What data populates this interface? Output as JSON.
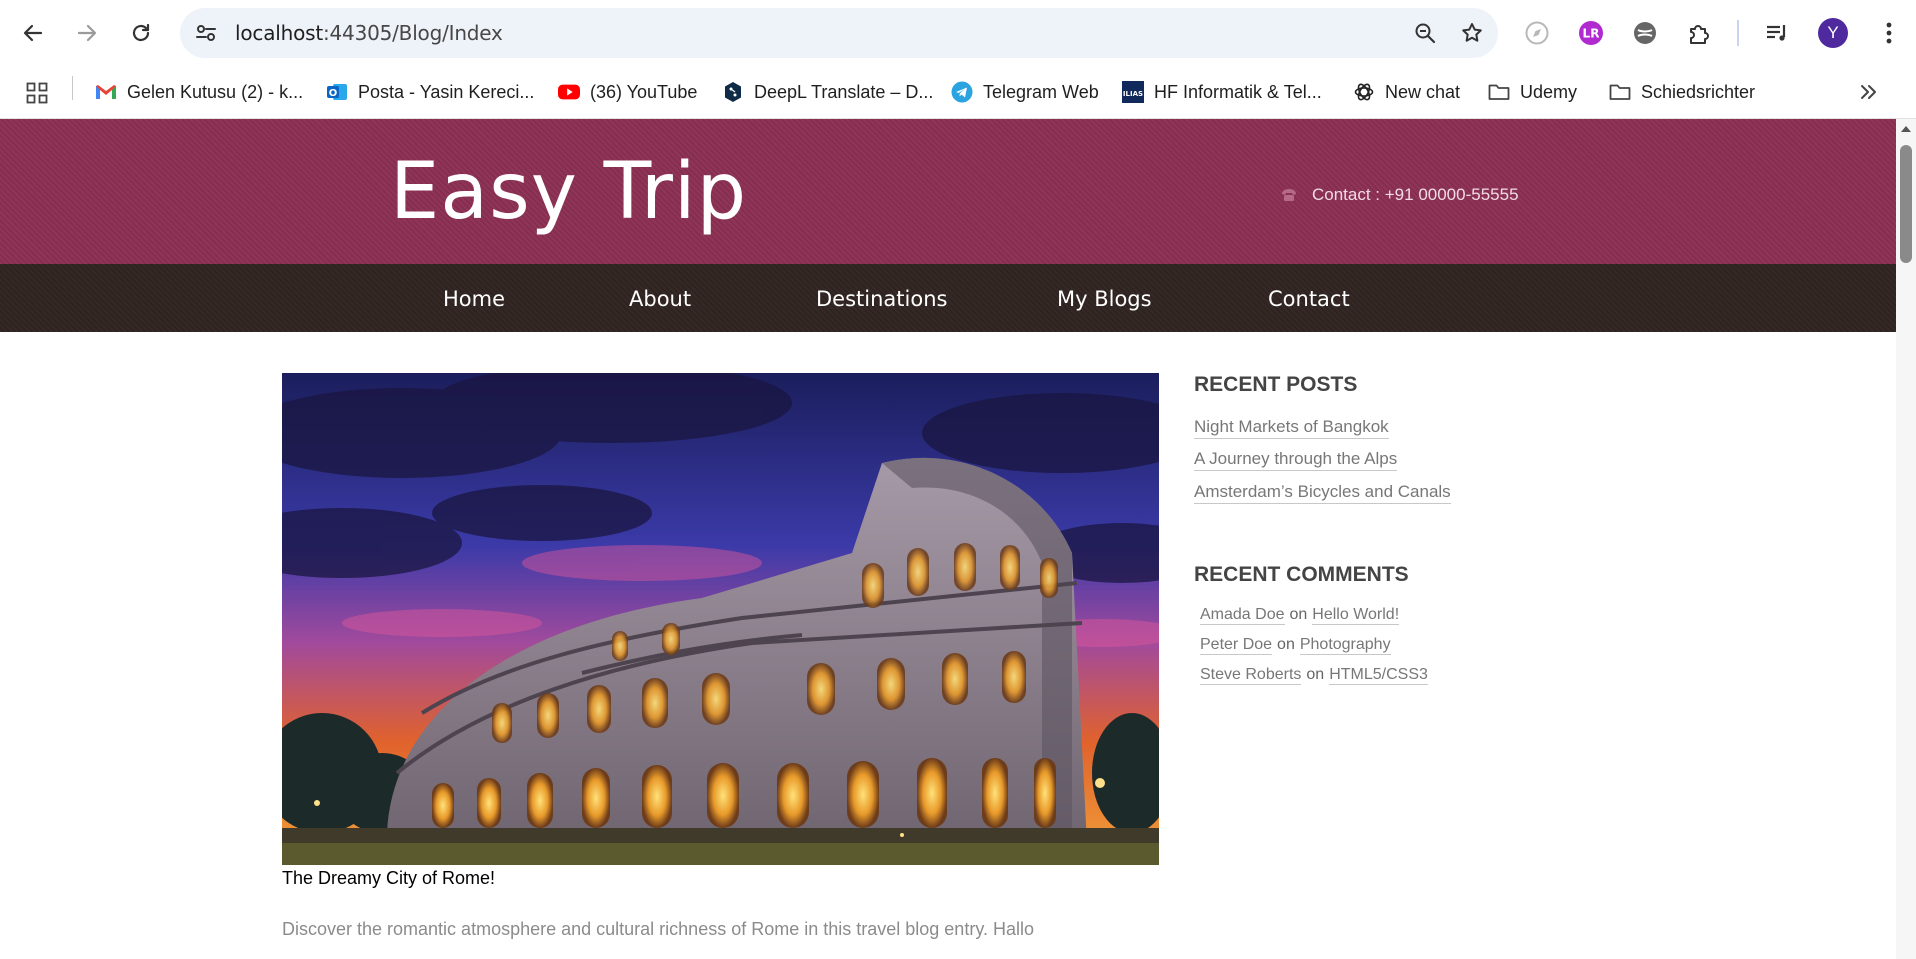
{
  "browser": {
    "url_host": "localhost",
    "url_rest": ":44305/Blog/Index",
    "avatar_letter": "Y"
  },
  "bookmarks": [
    {
      "label": "Gelen Kutusu (2) - k...",
      "icon": "gmail-icon"
    },
    {
      "label": "Posta - Yasin Kereci...",
      "icon": "outlook-icon"
    },
    {
      "label": "(36) YouTube",
      "icon": "youtube-icon"
    },
    {
      "label": "DeepL Translate – D...",
      "icon": "deepl-icon"
    },
    {
      "label": "Telegram Web",
      "icon": "telegram-icon"
    },
    {
      "label": "HF Informatik & Tel...",
      "icon": "ilias-icon"
    },
    {
      "label": "New chat",
      "icon": "openai-icon"
    },
    {
      "label": "Udemy",
      "icon": "folder-icon"
    },
    {
      "label": "Schiedsrichter",
      "icon": "folder-icon"
    }
  ],
  "site": {
    "logo": "Easy Trip",
    "contact": "Contact : +91 00000-55555",
    "brand_color": "#8b2f53",
    "nav_color": "#302421",
    "nav": [
      "Home",
      "About",
      "Destinations",
      "My Blogs",
      "Contact"
    ]
  },
  "post": {
    "title": "The Dreamy City of Rome!",
    "excerpt": "Discover the romantic atmosphere and cultural richness of Rome in this travel blog entry. Hallo"
  },
  "sidebar": {
    "recent_posts_heading": "RECENT POSTS",
    "recent_posts": [
      "Night Markets of Bangkok",
      "A Journey through the Alps",
      "Amsterdam’s Bicycles and Canals"
    ],
    "recent_comments_heading": "RECENT COMMENTS",
    "comments": [
      {
        "author": "Amada Doe",
        "on": "on",
        "post": "Hello World!"
      },
      {
        "author": "Peter Doe",
        "on": "on",
        "post": "Photography"
      },
      {
        "author": "Steve Roberts",
        "on": "on",
        "post": "HTML5/CSS3"
      }
    ]
  }
}
